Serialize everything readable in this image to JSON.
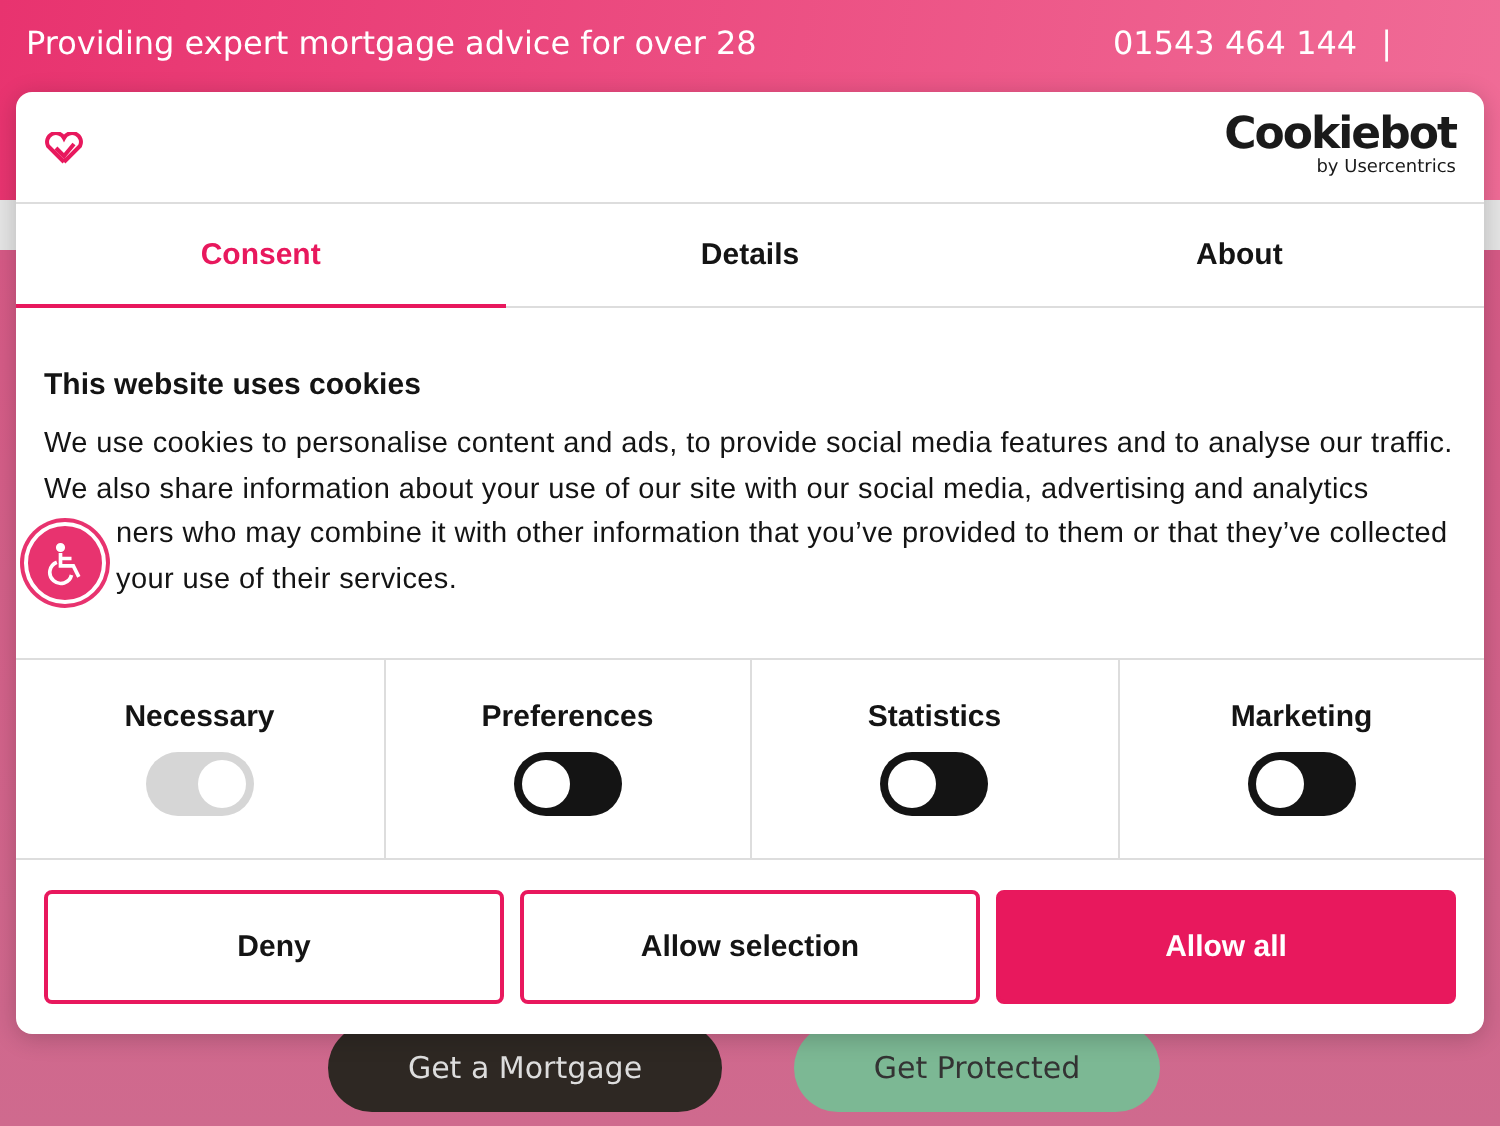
{
  "page": {
    "tagline": "Providing expert mortgage advice for over 28",
    "phone": "01543 464 144",
    "separator": "|",
    "hero_buttons": [
      {
        "label": "Get a Mortgage",
        "kind": "dark"
      },
      {
        "label": "Get Protected",
        "kind": "green"
      }
    ]
  },
  "dialog": {
    "brand": {
      "name": "Cookiebot",
      "byline": "by Usercentrics"
    },
    "tabs": [
      {
        "label": "Consent",
        "selected": true
      },
      {
        "label": "Details",
        "selected": false
      },
      {
        "label": "About",
        "selected": false
      }
    ],
    "heading": "This website uses cookies",
    "body_lines": [
      "We use cookies to personalise content and ads, to provide social media features and to analyse our traffic.",
      "We also share information about your use of our site with our social media, advertising and analytics",
      "ners who may combine it with other information that you’ve provided to them or that they’ve collected",
      "your use of their services."
    ],
    "categories": [
      {
        "label": "Necessary",
        "checked": true,
        "disabled": true
      },
      {
        "label": "Preferences",
        "checked": false,
        "disabled": false
      },
      {
        "label": "Statistics",
        "checked": false,
        "disabled": false
      },
      {
        "label": "Marketing",
        "checked": false,
        "disabled": false
      }
    ],
    "buttons": [
      {
        "label": "Deny",
        "kind": "outline"
      },
      {
        "label": "Allow selection",
        "kind": "outline"
      },
      {
        "label": "Allow all",
        "kind": "filled"
      }
    ]
  }
}
